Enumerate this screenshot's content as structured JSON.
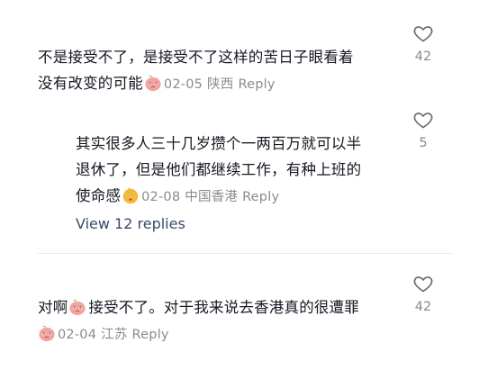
{
  "comments": [
    {
      "line1": "不是接受不了，是接受不了这样的苦日子眼看着",
      "line2": "没有改变的可能",
      "emoji": "peach-face-emoji",
      "date": "02-05",
      "location": "陕西",
      "reply": "Reply",
      "likes": "42"
    },
    {
      "line1": "其实很多人三十几岁攒个一两百万就可以半",
      "line2": "退休了，但是他们都继续工作，有种上班的",
      "line3": "使命感",
      "emoji": "orange-face-emoji",
      "date": "02-08",
      "location": "中国香港",
      "reply": "Reply",
      "likes": "5"
    },
    {
      "pre": "对啊",
      "line1": "接受不了。对于我来说去香港真的很遭罪",
      "emoji": "peach-face-emoji",
      "date": "02-04",
      "location": "江苏",
      "reply": "Reply",
      "likes": "42"
    }
  ],
  "view_replies": "View 12 replies",
  "colors": {
    "text": "#161823",
    "meta": "#8a8b91",
    "link": "#3a4a6b",
    "peach": "#f08a86",
    "orange": "#f7b733"
  }
}
